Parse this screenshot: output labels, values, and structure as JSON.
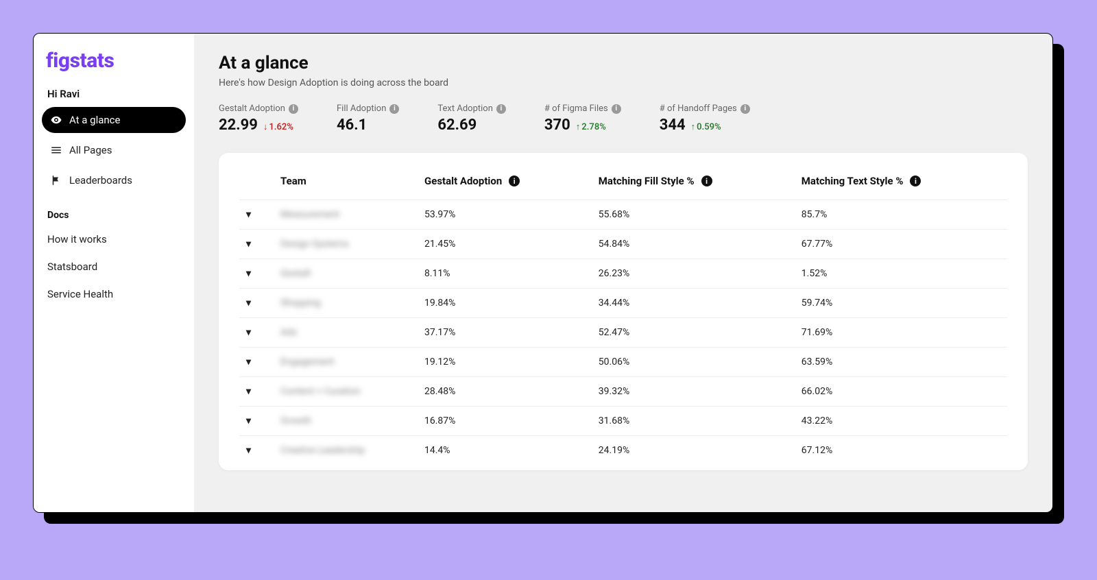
{
  "brand": "figstats",
  "greeting": "Hi Ravi",
  "nav": [
    {
      "label": "At a glance",
      "icon": "eye",
      "active": true
    },
    {
      "label": "All Pages",
      "icon": "list",
      "active": false
    },
    {
      "label": "Leaderboards",
      "icon": "flag",
      "active": false
    }
  ],
  "docs_header": "Docs",
  "docs_links": [
    {
      "label": "How it works"
    },
    {
      "label": "Statsboard"
    },
    {
      "label": "Service Health"
    }
  ],
  "page": {
    "title": "At a glance",
    "subtitle": "Here's how Design Adoption is doing across the board"
  },
  "metrics": [
    {
      "label": "Gestalt Adoption",
      "value": "22.99",
      "delta": "1.62%",
      "direction": "down"
    },
    {
      "label": "Fill Adoption",
      "value": "46.1",
      "delta": "",
      "direction": ""
    },
    {
      "label": "Text Adoption",
      "value": "62.69",
      "delta": "",
      "direction": ""
    },
    {
      "label": "# of Figma Files",
      "value": "370",
      "delta": "2.78%",
      "direction": "up"
    },
    {
      "label": "# of Handoff Pages",
      "value": "344",
      "delta": "0.59%",
      "direction": "up"
    }
  ],
  "table": {
    "columns": [
      "Team",
      "Gestalt Adoption",
      "Matching Fill Style %",
      "Matching Text Style %"
    ],
    "rows": [
      {
        "team": "Measurement",
        "gestalt": "53.97%",
        "fill": "55.68%",
        "text": "85.7%"
      },
      {
        "team": "Design Systems",
        "gestalt": "21.45%",
        "fill": "54.84%",
        "text": "67.77%"
      },
      {
        "team": "Gestalt",
        "gestalt": "8.11%",
        "fill": "26.23%",
        "text": "1.52%"
      },
      {
        "team": "Shopping",
        "gestalt": "19.84%",
        "fill": "34.44%",
        "text": "59.74%"
      },
      {
        "team": "Ads",
        "gestalt": "37.17%",
        "fill": "52.47%",
        "text": "71.69%"
      },
      {
        "team": "Engagement",
        "gestalt": "19.12%",
        "fill": "50.06%",
        "text": "63.59%"
      },
      {
        "team": "Content + Curation",
        "gestalt": "28.48%",
        "fill": "39.32%",
        "text": "66.02%"
      },
      {
        "team": "Growth",
        "gestalt": "16.87%",
        "fill": "31.68%",
        "text": "43.22%"
      },
      {
        "team": "Creative Leadership",
        "gestalt": "14.4%",
        "fill": "24.19%",
        "text": "67.12%"
      }
    ]
  }
}
